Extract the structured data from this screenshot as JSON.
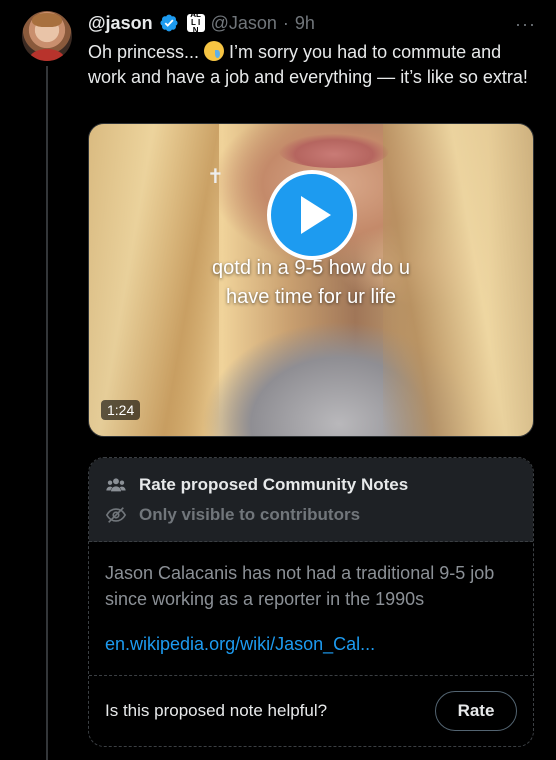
{
  "tweet": {
    "display_name": "@jason",
    "badge_text": "ALL IN",
    "handle": "@Jason",
    "separator": "·",
    "time": "9h",
    "more": "···",
    "text_before_emoji": "Oh princess... ",
    "text_after_emoji": " I’m sorry you had to commute and work and have a job and everything — it’s like so extra!",
    "emoji": "crying-face"
  },
  "video": {
    "caption_line1": "qotd in a 9-5 how do u",
    "caption_line2": "have time for ur life",
    "duration": "1:24"
  },
  "community_notes": {
    "title": "Rate proposed Community Notes",
    "subtitle": "Only visible to contributors",
    "note_text": "Jason Calacanis has not had a traditional 9-5 job since working as a reporter in the 1990s",
    "link": "en.wikipedia.org/wiki/Jason_Cal...",
    "question": "Is this proposed note helpful?",
    "rate_label": "Rate"
  },
  "colors": {
    "background": "#000000",
    "accent": "#1d9bf0",
    "secondary_text": "#71767b"
  }
}
